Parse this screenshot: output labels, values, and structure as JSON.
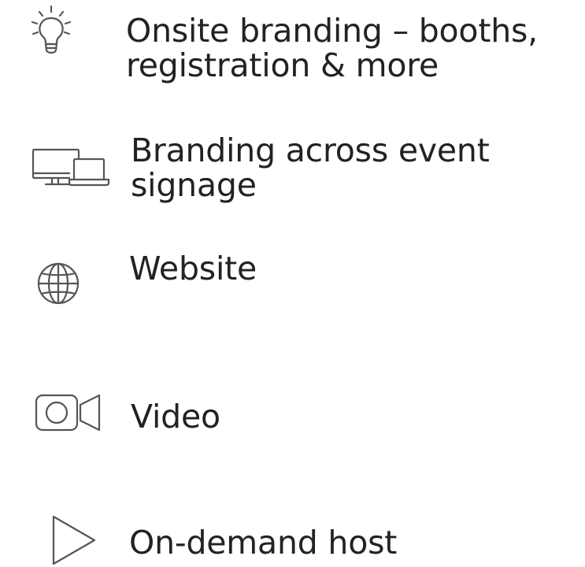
{
  "features": [
    {
      "icon": "lightbulb-icon",
      "line1": "Onsite branding – booths,",
      "line2": "registration & more"
    },
    {
      "icon": "devices-icon",
      "line1": "Branding across event",
      "line2": "signage"
    },
    {
      "icon": "globe-icon",
      "line1": "Website"
    },
    {
      "icon": "video-camera-icon",
      "line1": "Video"
    },
    {
      "icon": "play-icon",
      "line1": "On-demand host"
    }
  ],
  "colors": {
    "text": "#222222",
    "icon_stroke": "#555555"
  }
}
